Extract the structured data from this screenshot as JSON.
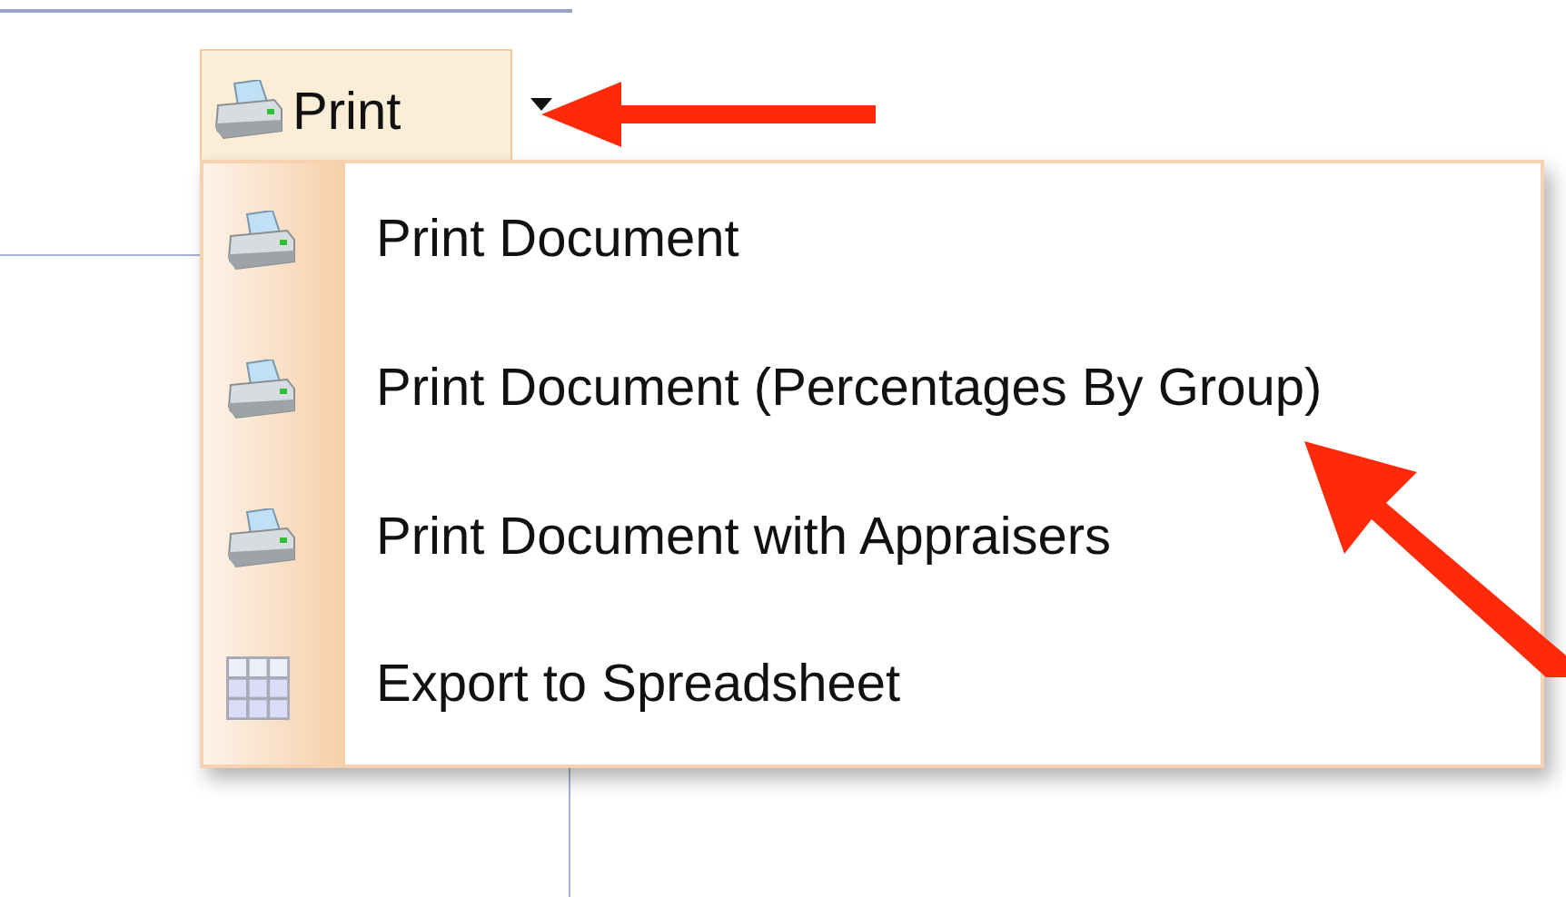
{
  "print_button": {
    "label": "Print"
  },
  "menu": {
    "items": [
      {
        "label": "Print Document",
        "kind": "printer"
      },
      {
        "label": "Print Document (Percentages By Group)",
        "kind": "printer"
      },
      {
        "label": "Print Document with Appraisers",
        "kind": "printer"
      },
      {
        "label": "Export to Spreadsheet",
        "kind": "spreadsheet"
      }
    ]
  }
}
